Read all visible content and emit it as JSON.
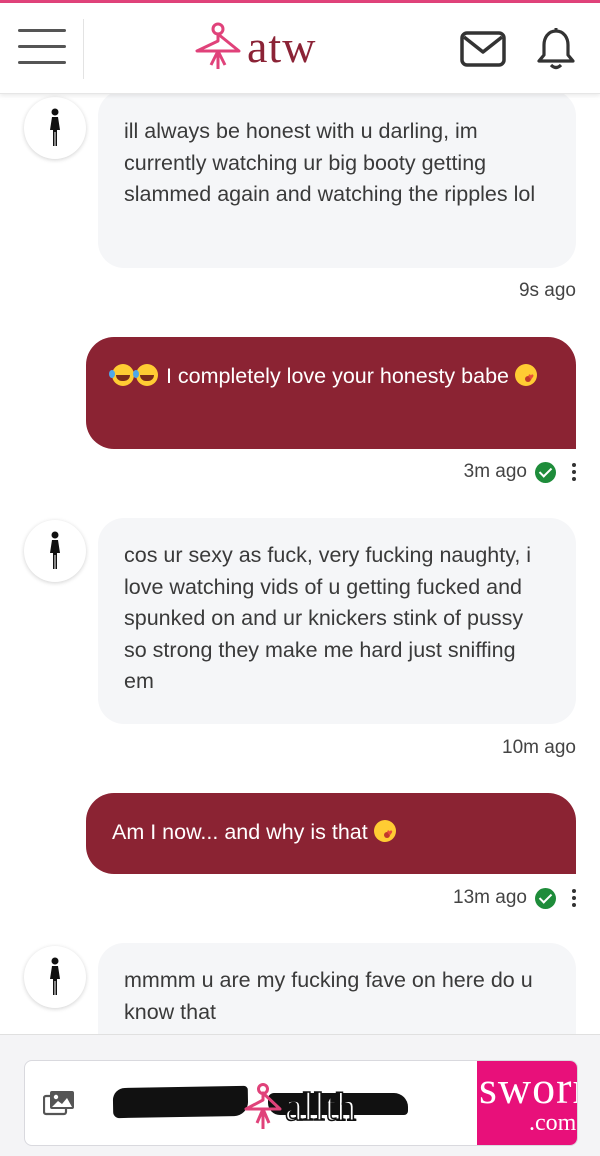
{
  "header": {
    "logo_text": "atw",
    "menu_icon": "hamburger-menu-icon",
    "mail_icon": "mail-icon",
    "bell_icon": "bell-icon",
    "brand_color": "#8b2336",
    "accent_color": "#e0427a"
  },
  "messages": [
    {
      "direction": "incoming",
      "text": "ill always be honest with u darling, im currently watching ur big booty getting slammed again and watching the ripples lol",
      "time": "9s ago"
    },
    {
      "direction": "outgoing",
      "text": "I completely love your honesty babe",
      "time": "3m ago",
      "delivered": true
    },
    {
      "direction": "incoming",
      "text": "cos ur sexy as fuck, very fucking naughty, i love watching vids of u getting fucked and spunked on and ur knickers stink of pussy so strong they make me hard just sniffing em",
      "time": "10m ago"
    },
    {
      "direction": "outgoing",
      "text": "Am I now... and why is that",
      "time": "13m ago",
      "delivered": true
    },
    {
      "direction": "incoming",
      "text": "mmmm u are my fucking fave on here do u know that",
      "time": ""
    }
  ],
  "colors": {
    "incoming_bubble": "#f5f6f8",
    "outgoing_bubble": "#8b2333",
    "delivered_check": "#1e8c3a"
  },
  "footer": {
    "gallery_icon": "image-gallery-icon",
    "ad_text": "allth",
    "ad_pink_text": "sworn",
    "ad_pink_sub": ".com"
  }
}
